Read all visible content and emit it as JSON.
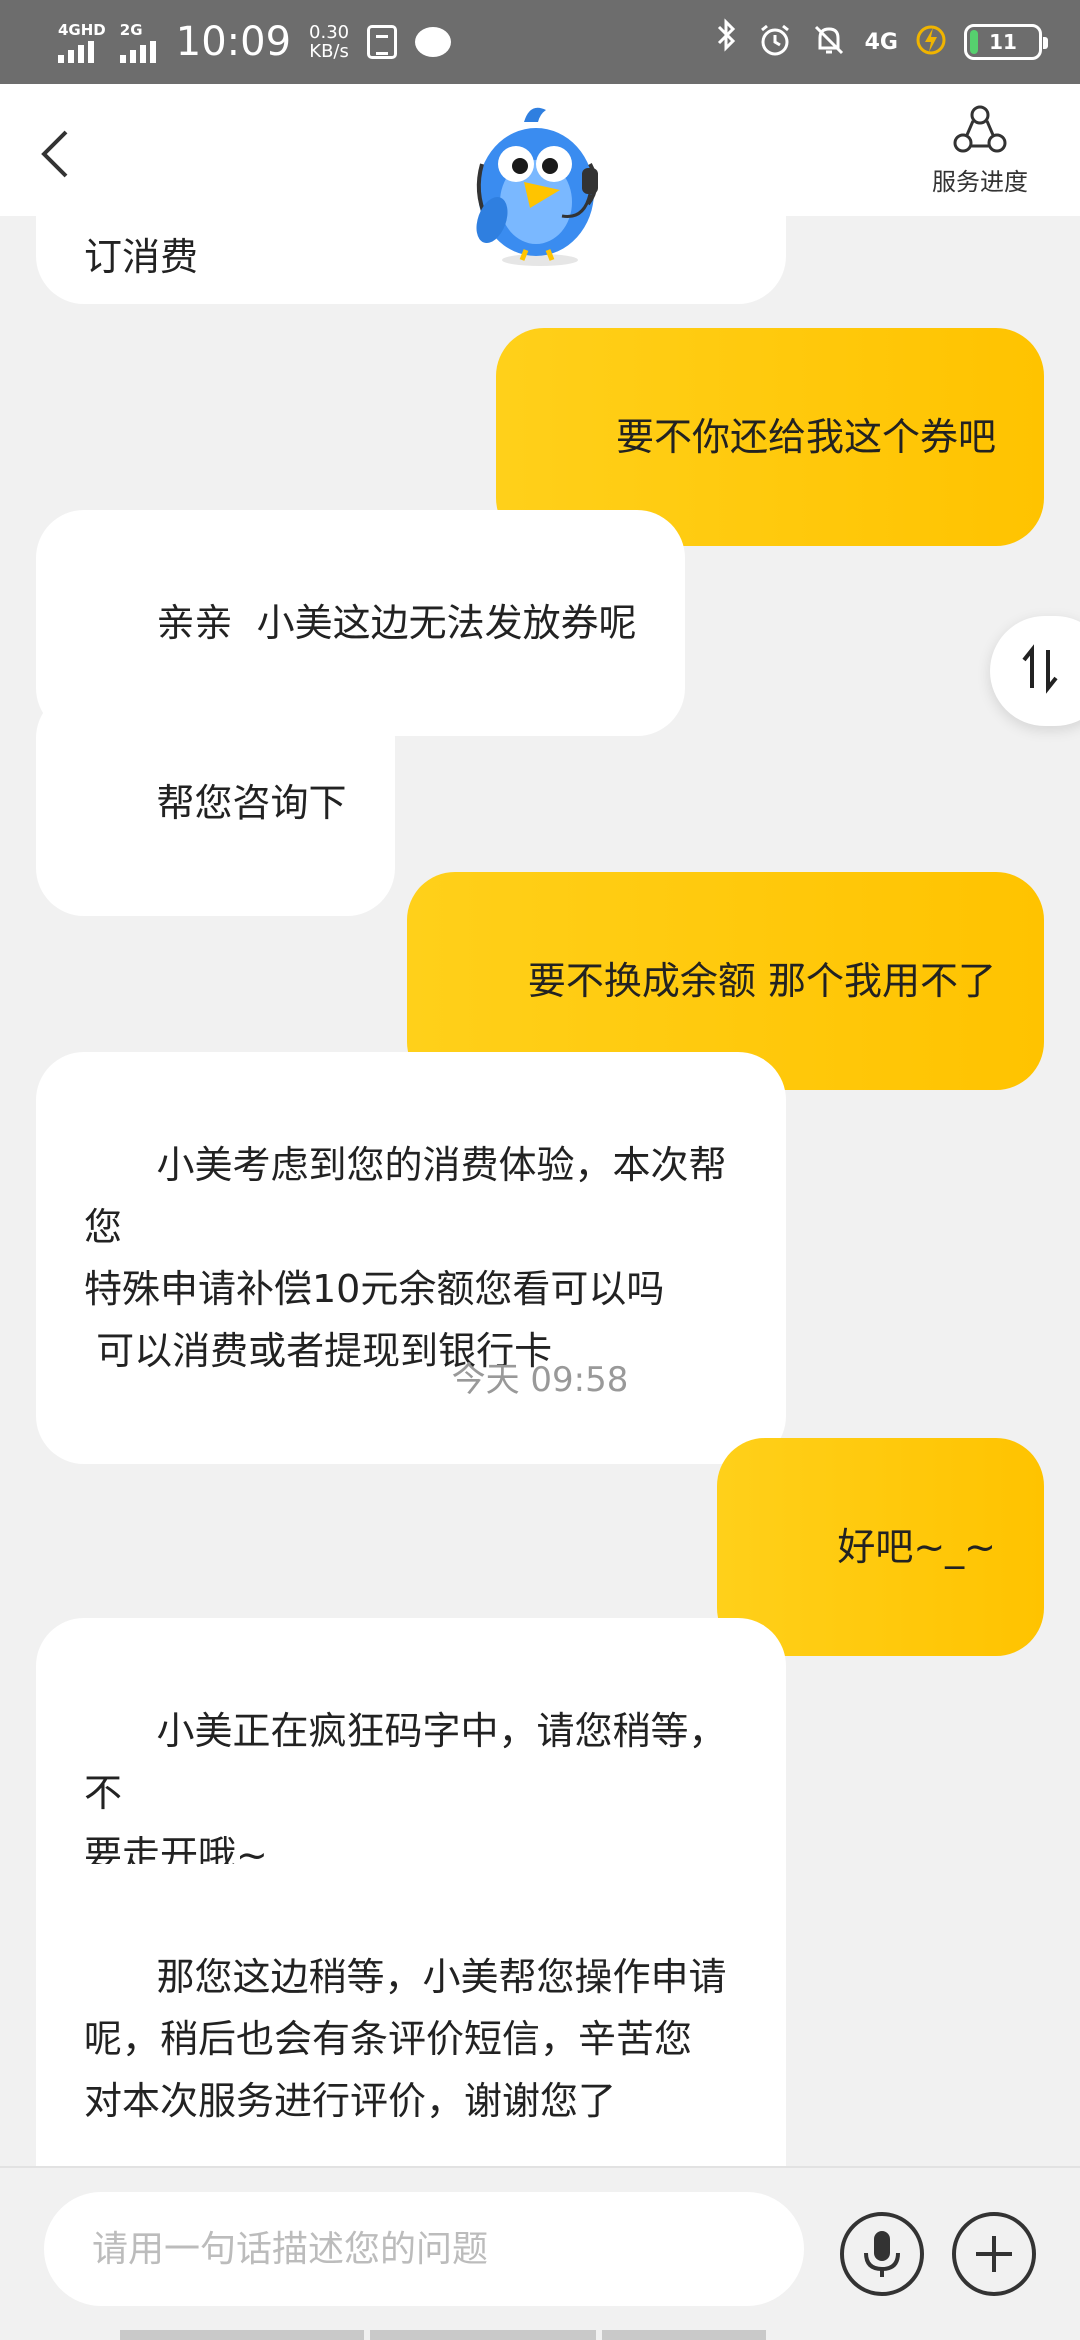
{
  "status_bar": {
    "sim1_label": "4GHD",
    "sim2_label": "2G",
    "time": "10:09",
    "speed_value": "0.30",
    "speed_unit": "KB/s",
    "network": "4G",
    "battery": "11",
    "battery_level": 0.11,
    "battery_color": "#56d06e"
  },
  "header": {
    "back_icon": "chevron-left-icon",
    "mascot_icon": "bird-mascot-icon",
    "service_progress_label": "服务进度"
  },
  "chat": {
    "partial_top": "订消费",
    "messages": [
      {
        "side": "right",
        "text": "要不你还给我这个券吧"
      },
      {
        "side": "left",
        "text": "亲亲  小美这边无法发放券呢"
      },
      {
        "side": "left",
        "text": "帮您咨询下"
      },
      {
        "side": "right",
        "text": "要不换成余额 那个我用不了"
      },
      {
        "side": "left",
        "text": "小美考虑到您的消费体验，本次帮您\n特殊申请补偿10元余额您看可以吗\n 可以消费或者提现到银行卡"
      },
      {
        "side": "time",
        "text": "今天 09:58"
      },
      {
        "side": "right",
        "text": "好吧~_~"
      },
      {
        "side": "left",
        "text": "小美正在疯狂码字中，请您稍等，不\n要走开哦~"
      },
      {
        "side": "left",
        "text": "那您这边稍等，小美帮您操作申请\n呢，稍后也会有条评价短信，辛苦您\n对本次服务进行评价，谢谢您了"
      }
    ]
  },
  "input": {
    "placeholder": "请用一句话描述您的问题",
    "value": ""
  },
  "colors": {
    "accent": "#ffc300",
    "bubble_left": "#ffffff",
    "background": "#f1f1f1"
  }
}
